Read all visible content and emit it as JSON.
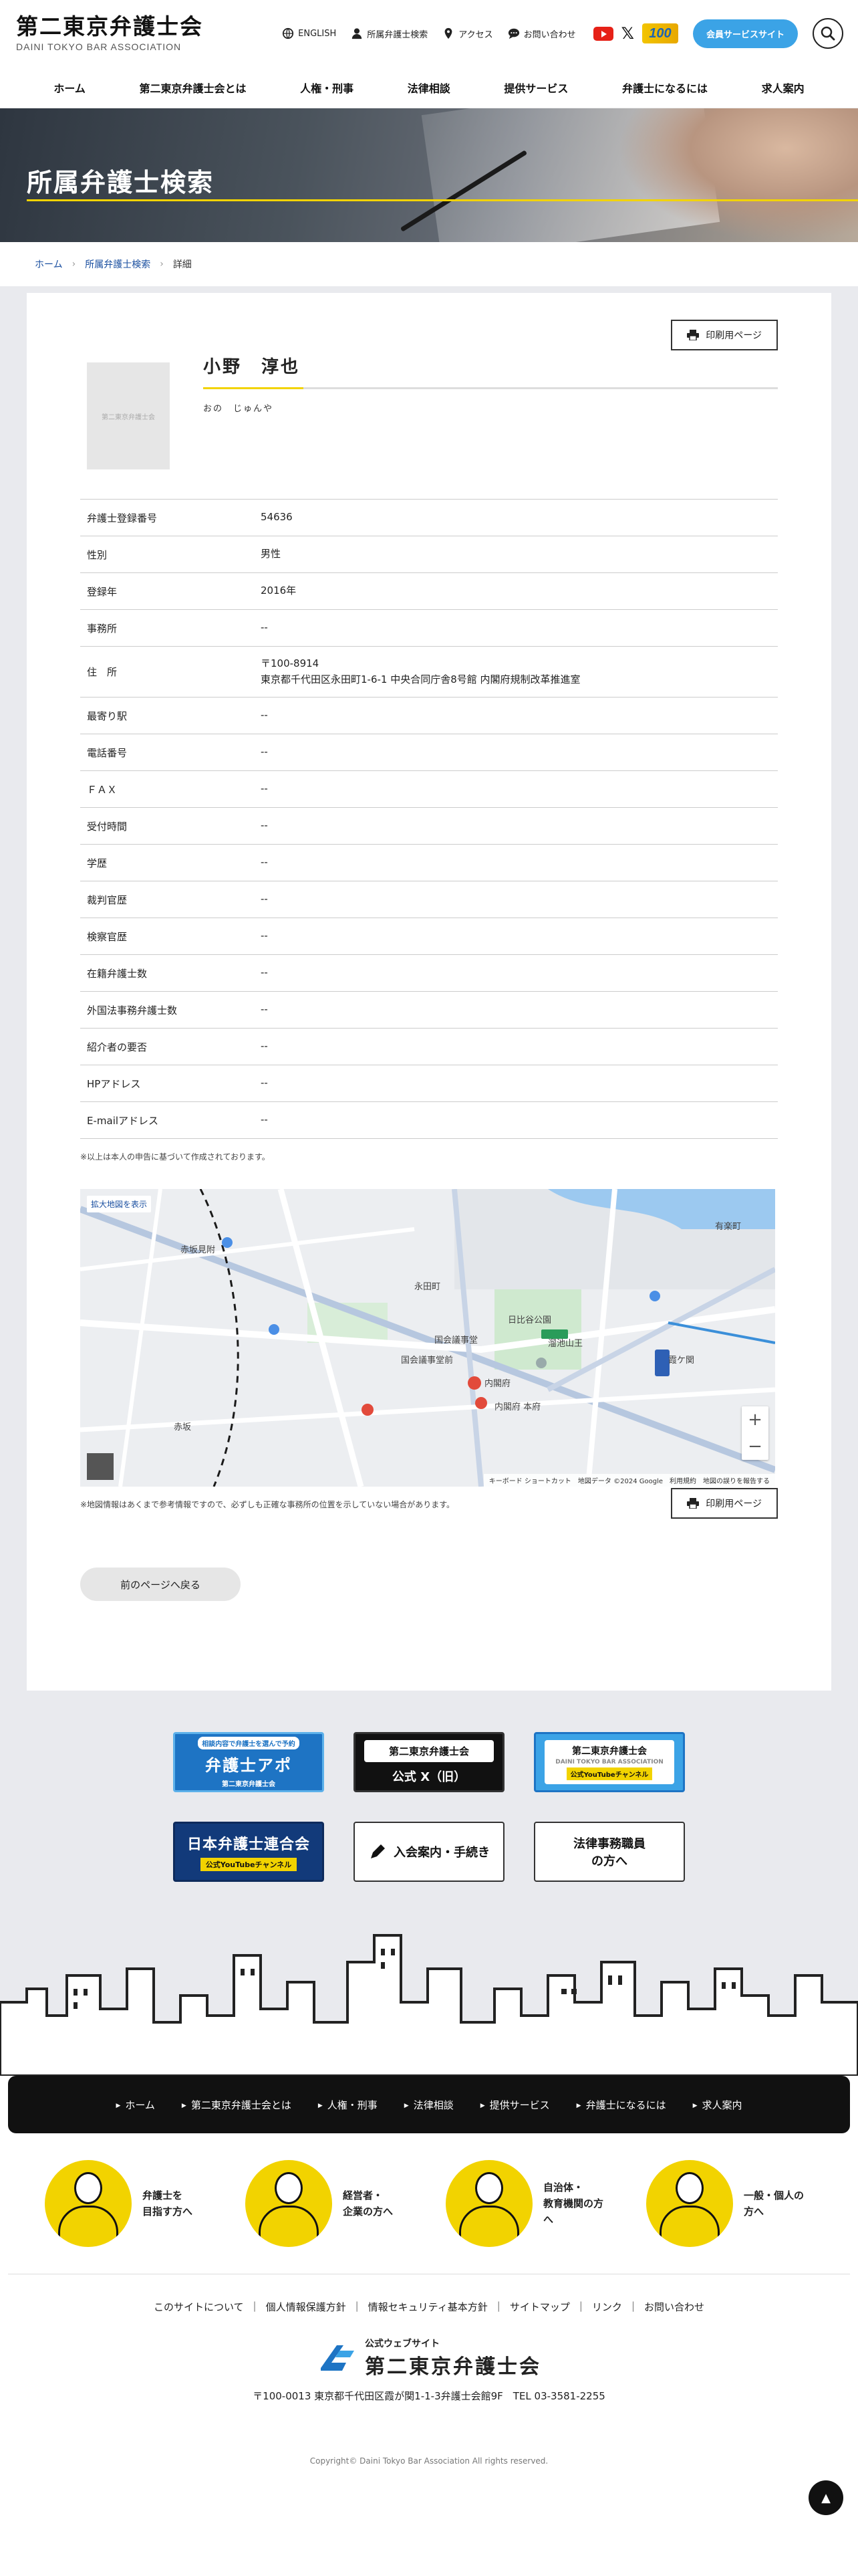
{
  "header": {
    "logo_jp": "第二東京弁護士会",
    "logo_en": "DAINI TOKYO BAR ASSOCIATION",
    "utility": {
      "english": "ENGLISH",
      "lawyer_search": "所属弁護士検索",
      "access": "アクセス",
      "contact": "お問い合わせ"
    },
    "badge": "100",
    "member_button": "会員サービスサイト"
  },
  "gnav": [
    "ホーム",
    "第二東京弁護士会とは",
    "人権・刑事",
    "法律相談",
    "提供サービス",
    "弁護士になるには",
    "求人案内"
  ],
  "hero": {
    "title": "所属弁護士検索"
  },
  "breadcrumb": {
    "home": "ホーム",
    "search": "所属弁護士検索",
    "current": "詳細"
  },
  "profile": {
    "print_label": "印刷用ページ",
    "photo_placeholder": "第二東京弁護士会",
    "name": "小野　淳也",
    "kana": "おの　じゅんや"
  },
  "details": [
    {
      "label": "弁護士登録番号",
      "value": "54636"
    },
    {
      "label": "性別",
      "value": "男性"
    },
    {
      "label": "登録年",
      "value": "2016年"
    },
    {
      "label": "事務所",
      "value": "--"
    },
    {
      "label": "住　所",
      "value": "〒100-8914",
      "value2": "東京都千代田区永田町1-6-1 中央合同庁舎8号館 内閣府規制改革推進室"
    },
    {
      "label": "最寄り駅",
      "value": "--"
    },
    {
      "label": "電話番号",
      "value": "--"
    },
    {
      "label": "ＦＡＸ",
      "value": "--"
    },
    {
      "label": "受付時間",
      "value": "--"
    },
    {
      "label": "学歴",
      "value": "--"
    },
    {
      "label": "裁判官歴",
      "value": "--"
    },
    {
      "label": "検察官歴",
      "value": "--"
    },
    {
      "label": "在籍弁護士数",
      "value": "--"
    },
    {
      "label": "外国法事務弁護士数",
      "value": "--"
    },
    {
      "label": "紹介者の要否",
      "value": "--"
    },
    {
      "label": "HPアドレス",
      "value": "--"
    },
    {
      "label": "E-mailアドレス",
      "value": "--"
    }
  ],
  "note": "※以上は本人の申告に基づいて作成されております。",
  "map": {
    "expand": "拡大地図を表示",
    "footer": "キーボード ショートカット　地図データ ©2024 Google　利用規約　地図の誤りを報告する",
    "labels": [
      "赤坂見附",
      "永田町",
      "国会議事堂前",
      "内閣府",
      "内閣府 本府",
      "霞ケ関",
      "日比谷公園",
      "溜池山王",
      "赤坂",
      "国会議事堂",
      "有楽町"
    ],
    "note": "※地図情報はあくまで参考情報ですので、必ずしも正確な事務所の位置を示していない場合があります。"
  },
  "back_label": "前のページへ戻る",
  "banners": {
    "b1_small": "相談内容で弁護士を選んで予約",
    "b1_big": "弁護士アポ",
    "b1_sub": "第二東京弁護士会",
    "b2_top": "第二東京弁護士会",
    "b2_bot": "公式 X（旧）",
    "b3_t1": "第二東京弁護士会",
    "b3_t2": "DAINI TOKYO BAR ASSOCIATION",
    "b3_t3": "公式YouTubeチャンネル",
    "b4_big": "日本弁護士連合会",
    "b4_sub": "公式YouTubeチャンネル",
    "b5": "入会案内・手続き",
    "b6_1": "法律事務職員",
    "b6_2": "の方へ"
  },
  "footer_nav": [
    "ホーム",
    "第二東京弁護士会とは",
    "人権・刑事",
    "法律相談",
    "提供サービス",
    "弁護士になるには",
    "求人案内"
  ],
  "personas": [
    {
      "l1": "弁護士を",
      "l2": "目指す方へ"
    },
    {
      "l1": "経営者・",
      "l2": "企業の方へ"
    },
    {
      "l1": "自治体・",
      "l2": "教育機関の方へ"
    },
    {
      "l1": "一般・個人の方へ",
      "l2": ""
    }
  ],
  "footer_links": [
    "このサイトについて",
    "個人情報保護方針",
    "情報セキュリティ基本方針",
    "サイトマップ",
    "リンク",
    "お問い合わせ"
  ],
  "footer": {
    "sub": "公式ウェブサイト",
    "name": "第二東京弁護士会",
    "address": "〒100-0013 東京都千代田区霞が関1-1-3弁護士会館9F　TEL 03-3581-2255",
    "copyright": "Copyright© Daini Tokyo Bar Association All rights reserved."
  },
  "colors": {
    "accent_yellow": "#f2d300",
    "brand_blue": "#3ba3e6",
    "link_blue": "#1a4fa0"
  }
}
